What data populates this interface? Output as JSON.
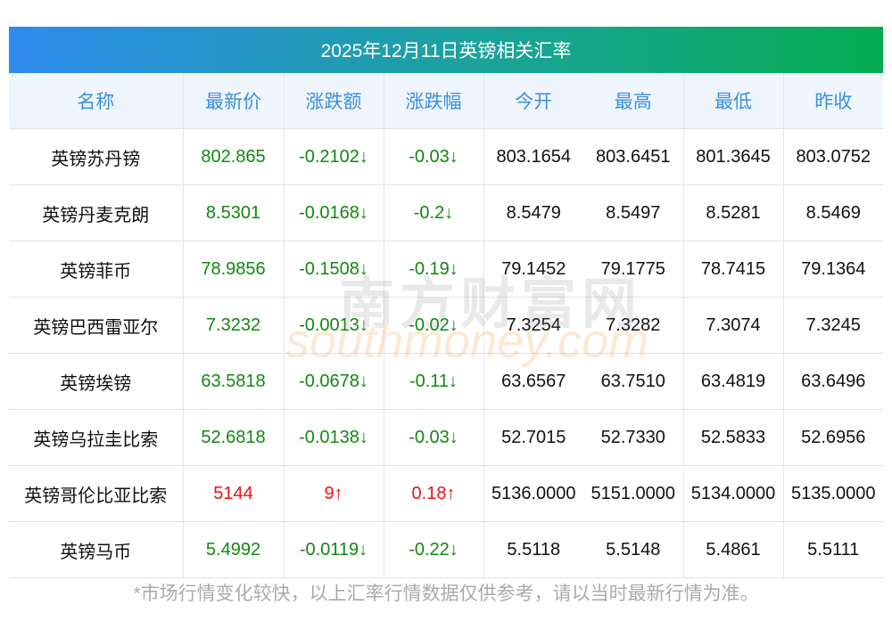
{
  "title": "2025年12月11日英镑相关汇率",
  "headers": [
    "名称",
    "最新价",
    "涨跌额",
    "涨跌幅",
    "今开",
    "最高",
    "最低",
    "昨收"
  ],
  "rows": [
    {
      "name": "英镑苏丹镑",
      "price": "802.865",
      "change": "-0.2102↓",
      "pct": "-0.03↓",
      "open": "803.1654",
      "high": "803.6451",
      "low": "801.3645",
      "prev": "803.0752",
      "dir": "down"
    },
    {
      "name": "英镑丹麦克朗",
      "price": "8.5301",
      "change": "-0.0168↓",
      "pct": "-0.2↓",
      "open": "8.5479",
      "high": "8.5497",
      "low": "8.5281",
      "prev": "8.5469",
      "dir": "down"
    },
    {
      "name": "英镑菲币",
      "price": "78.9856",
      "change": "-0.1508↓",
      "pct": "-0.19↓",
      "open": "79.1452",
      "high": "79.1775",
      "low": "78.7415",
      "prev": "79.1364",
      "dir": "down"
    },
    {
      "name": "英镑巴西雷亚尔",
      "price": "7.3232",
      "change": "-0.0013↓",
      "pct": "-0.02↓",
      "open": "7.3254",
      "high": "7.3282",
      "low": "7.3074",
      "prev": "7.3245",
      "dir": "down"
    },
    {
      "name": "英镑埃镑",
      "price": "63.5818",
      "change": "-0.0678↓",
      "pct": "-0.11↓",
      "open": "63.6567",
      "high": "63.7510",
      "low": "63.4819",
      "prev": "63.6496",
      "dir": "down"
    },
    {
      "name": "英镑乌拉圭比索",
      "price": "52.6818",
      "change": "-0.0138↓",
      "pct": "-0.03↓",
      "open": "52.7015",
      "high": "52.7330",
      "low": "52.5833",
      "prev": "52.6956",
      "dir": "down"
    },
    {
      "name": "英镑哥伦比亚比索",
      "price": "5144",
      "change": "9↑",
      "pct": "0.18↑",
      "open": "5136.0000",
      "high": "5151.0000",
      "low": "5134.0000",
      "prev": "5135.0000",
      "dir": "up"
    },
    {
      "name": "英镑马币",
      "price": "5.4992",
      "change": "-0.0119↓",
      "pct": "-0.22↓",
      "open": "5.5118",
      "high": "5.5148",
      "low": "5.4861",
      "prev": "5.5111",
      "dir": "down"
    }
  ],
  "watermark": {
    "cn": "南方财富网",
    "en": "southmoney.com"
  },
  "footer": "*市场行情变化较快，以上汇率行情数据仅供参考，请以当时最新行情为准。",
  "colors": {
    "up": "#ee1111",
    "down": "#118811",
    "header_text": "#3c8fdd"
  }
}
